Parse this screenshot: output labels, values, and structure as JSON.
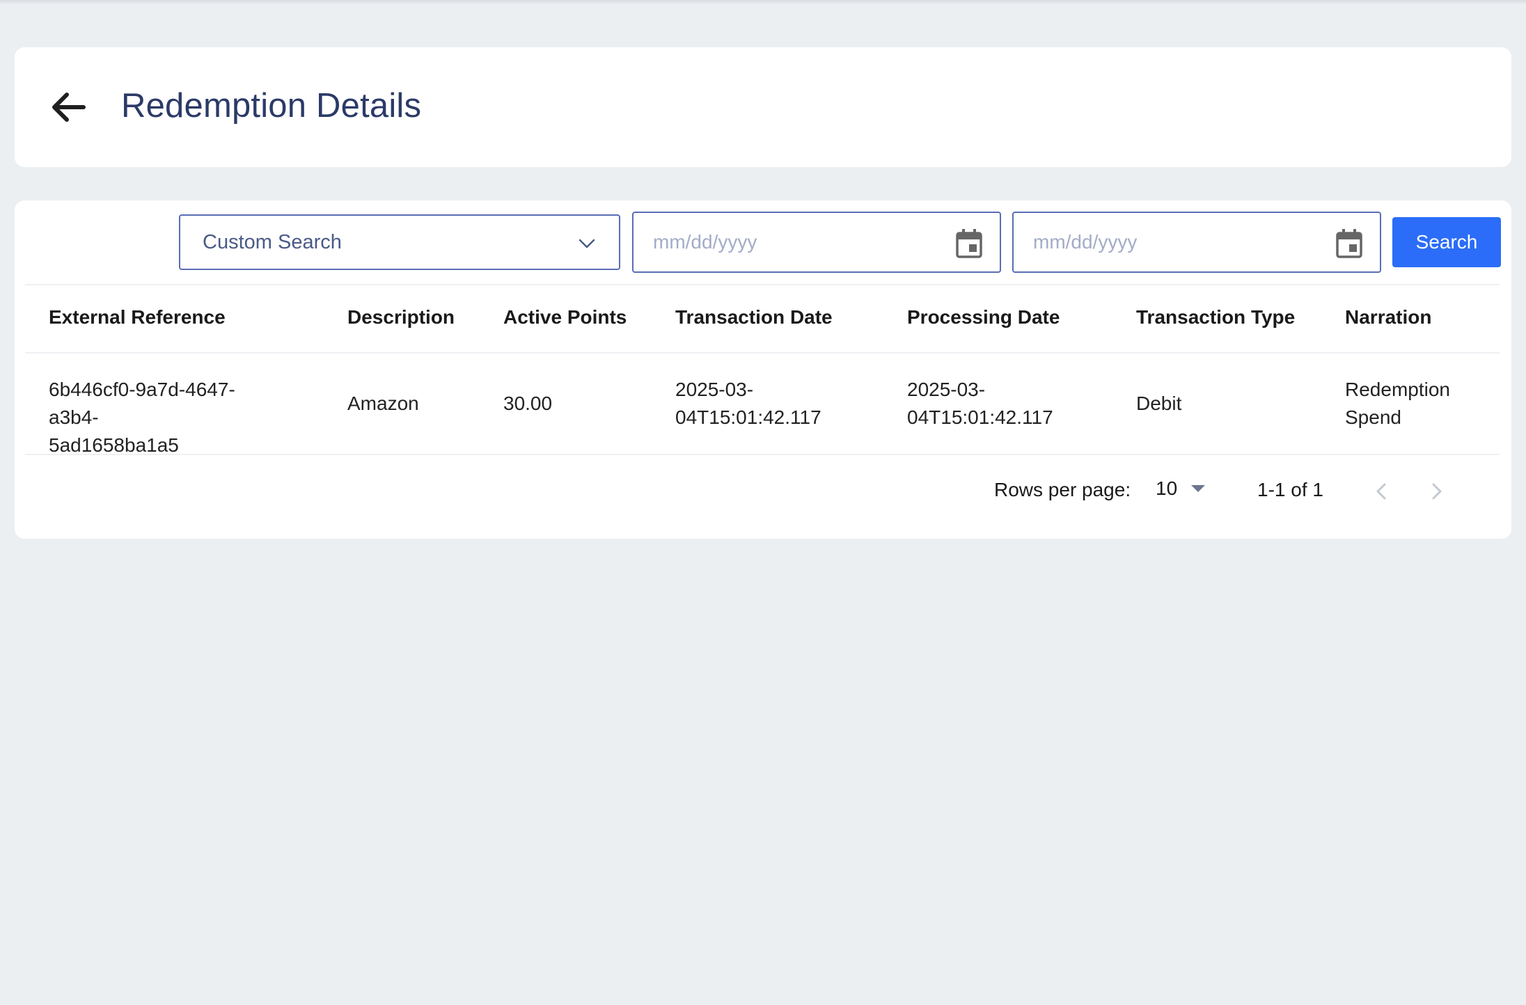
{
  "header": {
    "title": "Redemption Details",
    "back_icon": "arrow-left-icon"
  },
  "filters": {
    "search_select_value": "Custom Search",
    "date_from_placeholder": "mm/dd/yyyy",
    "date_to_placeholder": "mm/dd/yyyy",
    "search_label": "Search"
  },
  "table": {
    "columns": [
      "External Reference",
      "Description",
      "Active Points",
      "Transaction Date",
      "Processing Date",
      "Transaction Type",
      "Narration"
    ],
    "rows": [
      {
        "external_reference_line1": "6b446cf0-9a7d-4647-a3b4-",
        "external_reference_line2": "5ad1658ba1a5",
        "description": "Amazon",
        "active_points": "30.00",
        "transaction_date_line1": "2025-03-",
        "transaction_date_line2": "04T15:01:42.117",
        "processing_date_line1": "2025-03-",
        "processing_date_line2": "04T15:01:42.117",
        "transaction_type": "Debit",
        "narration_line1": "Redemption",
        "narration_line2": "Spend"
      }
    ]
  },
  "pagination": {
    "rows_per_page_label": "Rows per page:",
    "rows_per_page_value": "10",
    "range_label": "1-1 of 1"
  },
  "colors": {
    "background": "#ebeff2",
    "title": "#2b3a67",
    "accent": "#2b6df8",
    "input_border": "#5a6db5"
  }
}
